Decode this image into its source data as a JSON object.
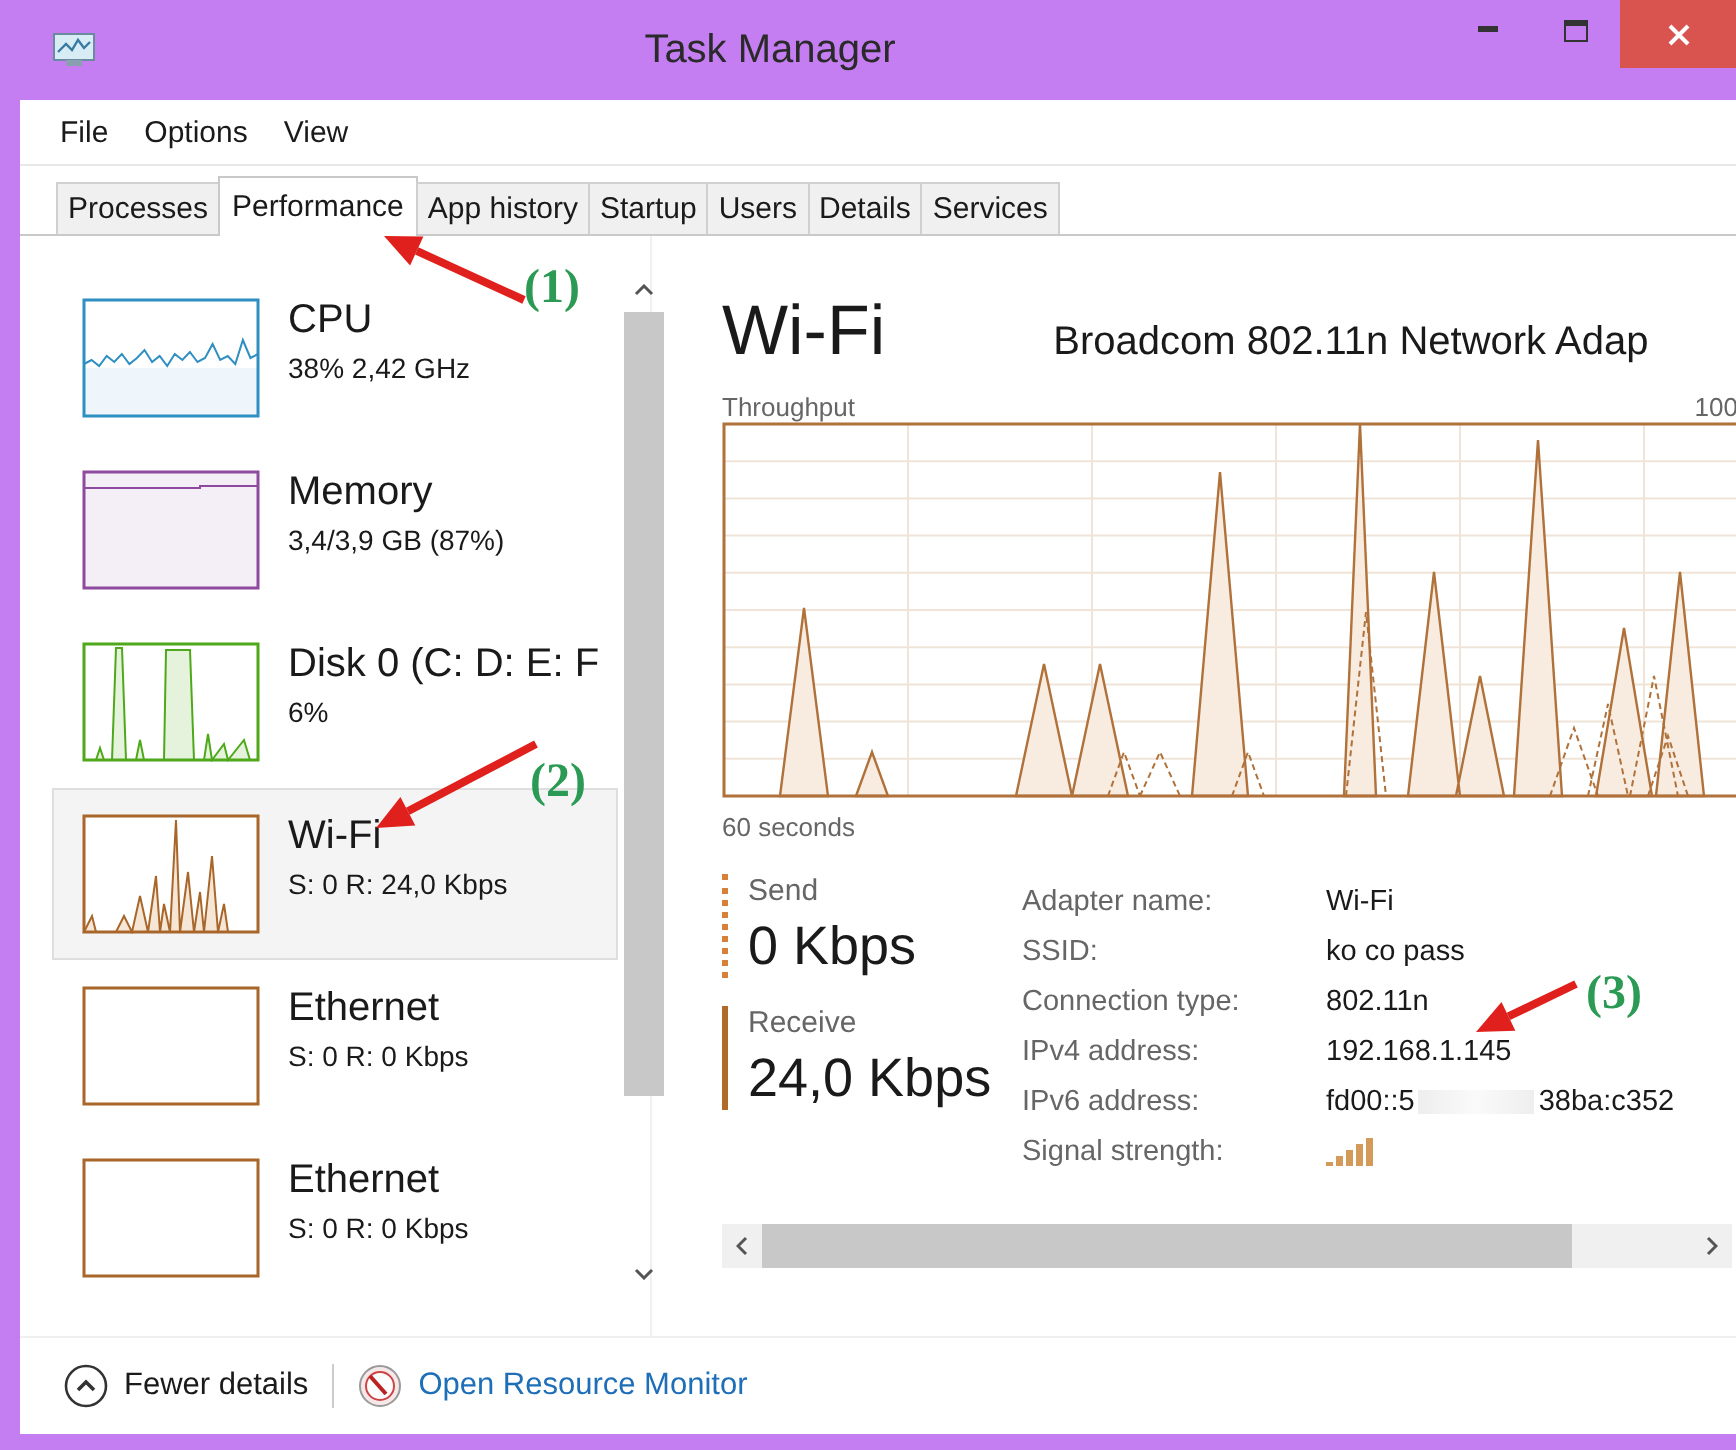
{
  "window": {
    "title": "Task Manager"
  },
  "menu": [
    "File",
    "Options",
    "View"
  ],
  "tabs": [
    {
      "label": "Processes",
      "selected": false
    },
    {
      "label": "Performance",
      "selected": true
    },
    {
      "label": "App history",
      "selected": false
    },
    {
      "label": "Startup",
      "selected": false
    },
    {
      "label": "Users",
      "selected": false
    },
    {
      "label": "Details",
      "selected": false
    },
    {
      "label": "Services",
      "selected": false
    }
  ],
  "sidebar": {
    "items": [
      {
        "kind": "cpu",
        "name": "CPU",
        "detail": "38% 2,42 GHz",
        "color": "#2f8fc2",
        "selected": false
      },
      {
        "kind": "memory",
        "name": "Memory",
        "detail": "3,4/3,9 GB (87%)",
        "color": "#8e4a9e",
        "selected": false
      },
      {
        "kind": "disk",
        "name": "Disk 0 (C: D: E: F",
        "detail": "6%",
        "color": "#4ea81a",
        "selected": false
      },
      {
        "kind": "wifi",
        "name": "Wi-Fi",
        "detail": "S: 0 R: 24,0 Kbps",
        "color": "#a8662a",
        "selected": true
      },
      {
        "kind": "ethernet",
        "name": "Ethernet",
        "detail": "S: 0 R: 0 Kbps",
        "color": "#a8662a",
        "selected": false
      },
      {
        "kind": "ethernet",
        "name": "Ethernet",
        "detail": "S: 0 R: 0 Kbps",
        "color": "#a8662a",
        "selected": false
      }
    ]
  },
  "detail": {
    "title": "Wi-Fi",
    "adapter": "Broadcom 802.11n Network Adap",
    "chart": {
      "label": "Throughput",
      "max": "100",
      "span": "60 seconds"
    },
    "send": {
      "label": "Send",
      "value": "0 Kbps"
    },
    "receive": {
      "label": "Receive",
      "value": "24,0 Kbps"
    },
    "properties": [
      {
        "kind": "text",
        "label": "Adapter name:",
        "value": "Wi-Fi"
      },
      {
        "kind": "text",
        "label": "SSID:",
        "value": "ko co pass"
      },
      {
        "kind": "text",
        "label": "Connection type:",
        "value": "802.11n"
      },
      {
        "kind": "text",
        "label": "IPv4 address:",
        "value": "192.168.1.145"
      },
      {
        "kind": "blurred",
        "label": "IPv6 address:",
        "value_start": "fd00::5",
        "value_end": "38ba:c352"
      },
      {
        "kind": "signal",
        "label": "Signal strength:"
      }
    ]
  },
  "footer": {
    "fewer": "Fewer details",
    "link": "Open Resource Monitor"
  },
  "annotations": [
    {
      "label": "(1)"
    },
    {
      "label": "(2)"
    },
    {
      "label": "(3)"
    }
  ]
}
